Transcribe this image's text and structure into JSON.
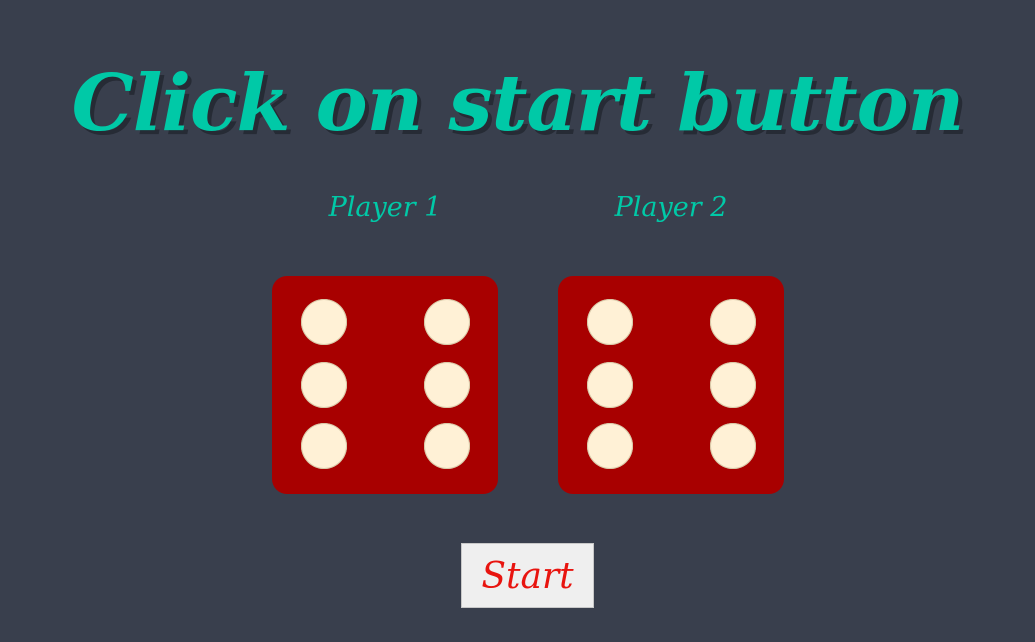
{
  "header": {
    "title": "Click on start button"
  },
  "players": [
    {
      "label": "Player 1",
      "die_face": 6
    },
    {
      "label": "Player 2",
      "die_face": 6
    }
  ],
  "controls": {
    "start_label": "Start"
  },
  "colors": {
    "background": "#393f4d",
    "accent": "#00c9a7",
    "die": "#a80000",
    "pip": "#fff1d6",
    "start_text": "#e8140f"
  }
}
